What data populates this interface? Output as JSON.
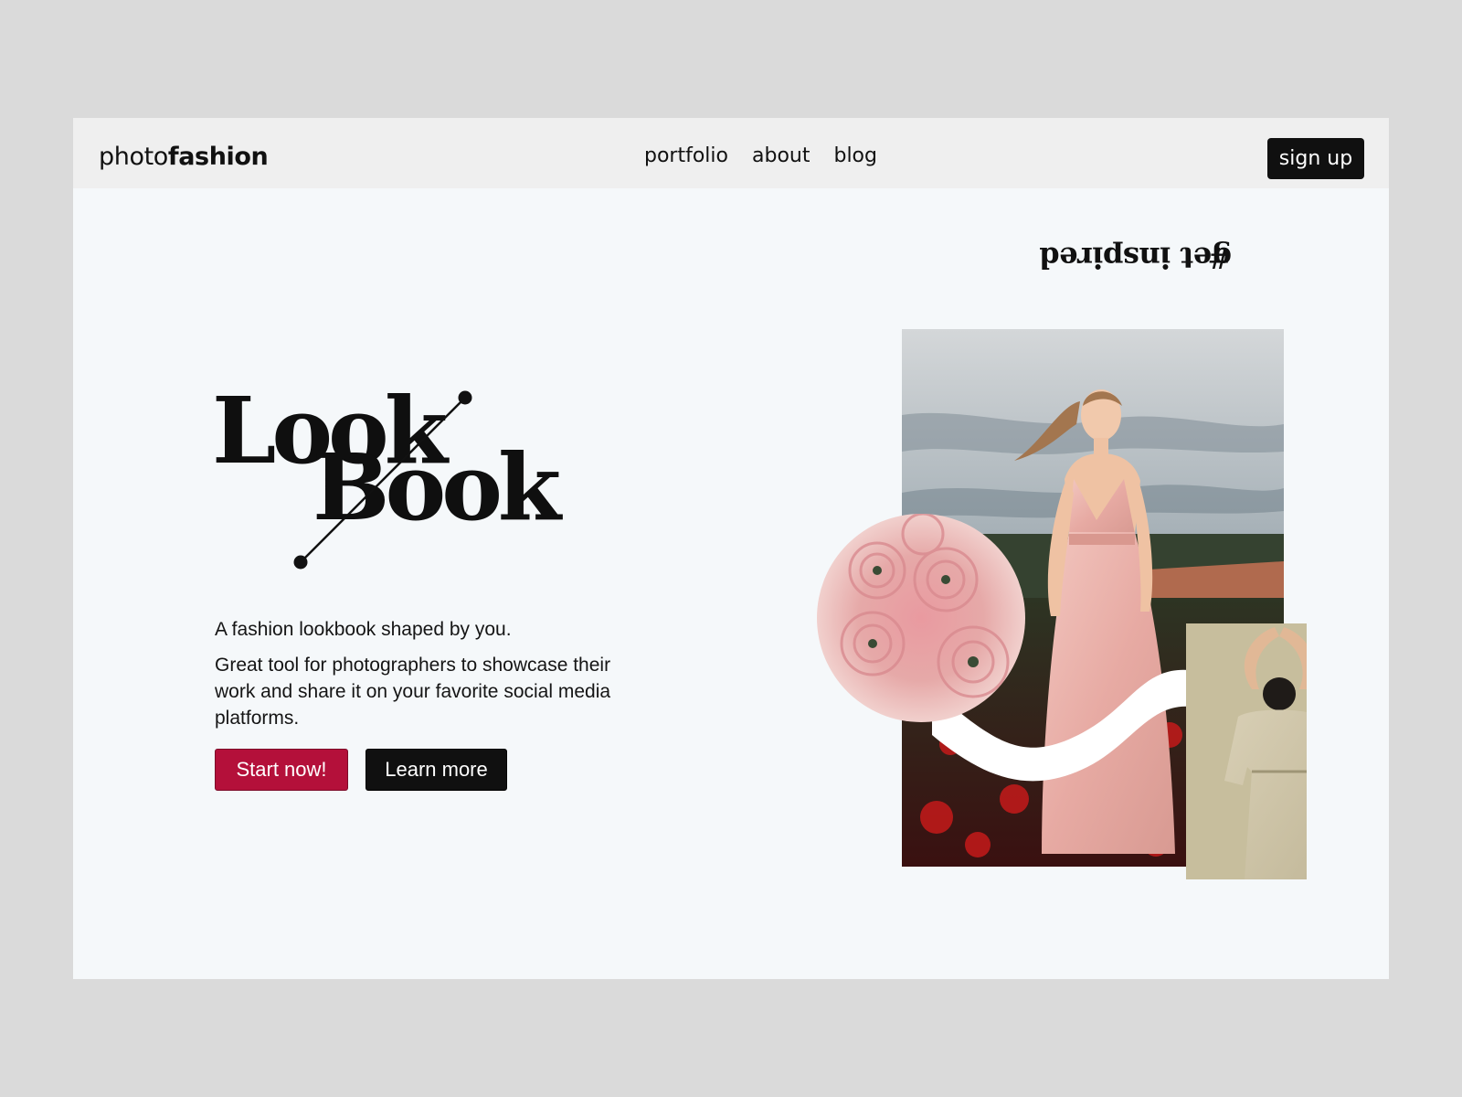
{
  "brand": {
    "light": "photo",
    "bold": "fashion"
  },
  "nav": {
    "links": [
      "portfolio",
      "about",
      "blog"
    ],
    "signup_label": "sign up"
  },
  "hero": {
    "title_line1": "Look",
    "title_line2": "Book",
    "tagline": "A fashion lookbook shaped by you.",
    "description": "Great tool for photographers to showcase their work and share it on your favorite social media platforms.",
    "primary_cta": "Start now!",
    "secondary_cta": "Learn more"
  },
  "side_text": {
    "hash": "#",
    "text": "get inspired"
  },
  "colors": {
    "accent": "#b4103a",
    "dark": "#101010",
    "background": "#f5f8fa",
    "nav_background": "#efefef"
  }
}
